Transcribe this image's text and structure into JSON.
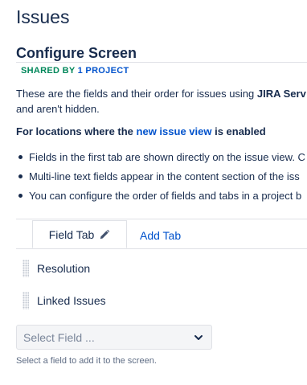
{
  "page": {
    "title": "Issues"
  },
  "screen": {
    "title": "Configure Screen",
    "shared_label": "SHARED BY",
    "shared_link": "1 PROJECT"
  },
  "description": {
    "line1_prefix": "These are the fields and their order for issues using ",
    "line1_bold": "JIRA Serv",
    "line2": "and aren't hidden."
  },
  "locations": {
    "prefix": "For locations where the ",
    "link": "new issue view",
    "suffix": " is enabled"
  },
  "bullets": [
    "Fields in the first tab are shown directly on the issue view. C",
    "Multi-line text fields appear in the content section of the iss",
    "You can configure the order of fields and tabs in a project b"
  ],
  "tabs": {
    "active": "Field Tab",
    "add": "Add Tab"
  },
  "fields": [
    "Resolution",
    "Linked Issues"
  ],
  "select_field": {
    "placeholder": "Select Field ...",
    "hint": "Select a field to add it to the screen."
  },
  "icons": {
    "edit": "pencil-icon",
    "dropdown": "chevron-down-icon",
    "drag": "drag-handle-icon"
  },
  "colors": {
    "text": "#172b4d",
    "link": "#0052cc",
    "shared": "#00875a"
  }
}
